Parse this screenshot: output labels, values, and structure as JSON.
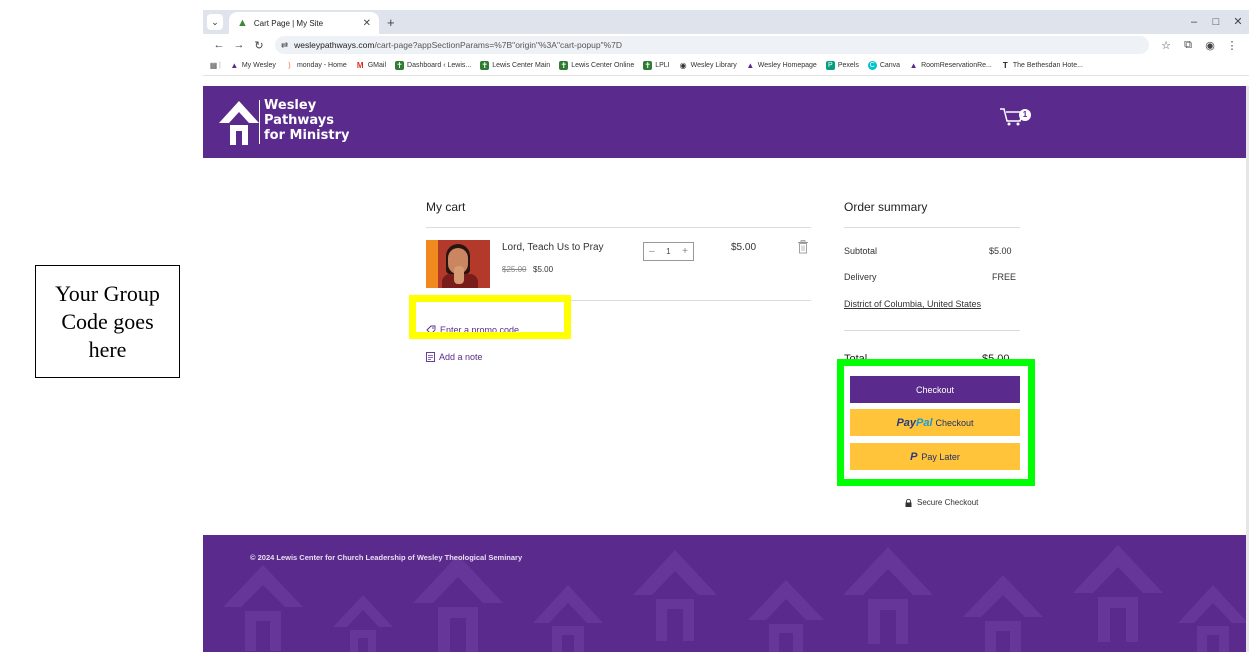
{
  "annotation": {
    "note_text": "Your Group Code goes here",
    "arrow_color": "#ff0000",
    "promo_highlight_color": "#ffff00",
    "checkout_highlight_color": "#00ff00"
  },
  "browser": {
    "tab_title": "Cart Page | My Site",
    "url_host": "wesleypathways.com",
    "url_path": "/cart-page?appSectionParams=%7B\"origin\"%3A\"cart-popup\"%7D",
    "bookmarks": [
      {
        "label": "My Wesley",
        "icon": "wesley-icon"
      },
      {
        "label": "monday - Home",
        "icon": "monday-icon"
      },
      {
        "label": "GMail",
        "icon": "gmail-icon"
      },
      {
        "label": "Dashboard ‹ Lewis...",
        "icon": "lewis-icon"
      },
      {
        "label": "Lewis Center Main",
        "icon": "lewis-icon"
      },
      {
        "label": "Lewis Center Online",
        "icon": "lewis-icon"
      },
      {
        "label": "LPLI",
        "icon": "lewis-icon"
      },
      {
        "label": "Wesley Library",
        "icon": "globe-icon"
      },
      {
        "label": "Wesley Homepage",
        "icon": "wesley-icon"
      },
      {
        "label": "Pexels",
        "icon": "pexels-icon"
      },
      {
        "label": "Canva",
        "icon": "canva-icon"
      },
      {
        "label": "RoomReservationRe...",
        "icon": "wesley-icon"
      },
      {
        "label": "The Bethesdan Hote...",
        "icon": "t-icon"
      }
    ]
  },
  "site": {
    "logo_line1": "Wesley",
    "logo_line2": "Pathways",
    "logo_line3": "for Ministry",
    "brand_color": "#5a2a8c",
    "cart_count": "1"
  },
  "cart": {
    "heading": "My cart",
    "item": {
      "name": "Lord, Teach Us to Pray",
      "original_price": "$25.00",
      "price": "$5.00",
      "quantity": "1",
      "line_total": "$5.00"
    },
    "promo_link": "Enter a promo code",
    "note_link": "Add a note"
  },
  "summary": {
    "heading": "Order summary",
    "subtotal_label": "Subtotal",
    "subtotal_value": "$5.00",
    "delivery_label": "Delivery",
    "delivery_value": "FREE",
    "location": "District of Columbia, United States",
    "total_label": "Total",
    "total_value": "$5.00",
    "checkout_label": "Checkout",
    "paypal_word1": "Pay",
    "paypal_word2": "Pal",
    "paypal_suffix": "Checkout",
    "pay_later_label": "Pay Later",
    "secure_label": "Secure Checkout"
  },
  "footer": {
    "copyright": "© 2024 Lewis Center for Church Leadership of Wesley Theological Seminary"
  }
}
